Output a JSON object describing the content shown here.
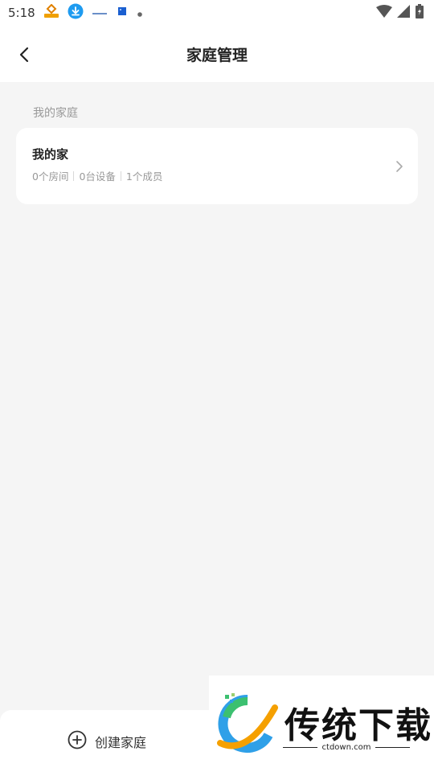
{
  "status_bar": {
    "time": "5:18"
  },
  "header": {
    "title": "家庭管理"
  },
  "section": {
    "label": "我的家庭"
  },
  "home_card": {
    "name": "我的家",
    "stats": [
      "0个房间",
      "0台设备",
      "1个成员"
    ]
  },
  "bottom_bar": {
    "create_label": "创建家庭"
  },
  "watermark": {
    "text": "传统下载",
    "url": "ctdown.com"
  },
  "colors": {
    "background": "#f5f5f5",
    "card": "#ffffff",
    "muted_text": "#999999"
  }
}
